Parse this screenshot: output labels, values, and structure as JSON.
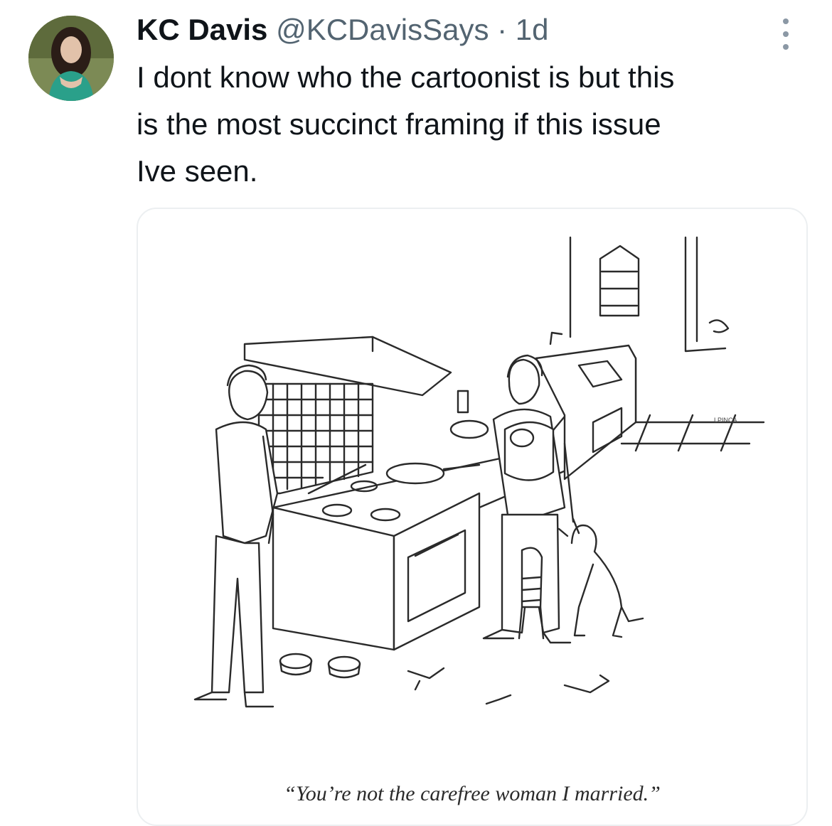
{
  "author": {
    "name": "KC Davis",
    "handle": "@KCDavisSays",
    "separator": "·",
    "time": "1d"
  },
  "icons": {
    "more": "more-options-icon",
    "avatar": "profile-avatar"
  },
  "tweet": {
    "text_lines": [
      "I dont know who the cartoonist is but this",
      "is the most succinct framing if this issue",
      "Ive seen."
    ]
  },
  "media": {
    "caption": "“You’re not the carefree woman I married.”"
  },
  "colors": {
    "text": "#0f1419",
    "secondary": "#536471",
    "border": "#eceff1"
  }
}
